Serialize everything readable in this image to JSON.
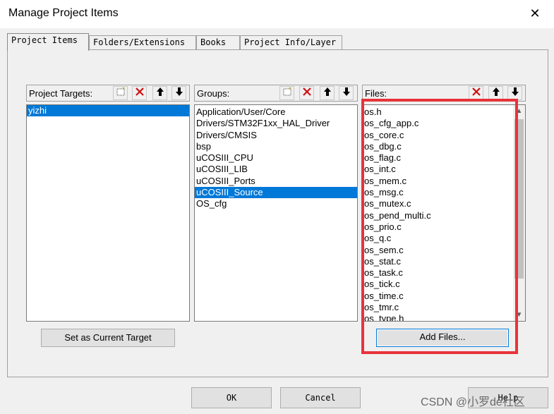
{
  "window": {
    "title": "Manage Project Items",
    "close_glyph": "✕"
  },
  "tabs": [
    {
      "label": "Project Items",
      "active": true
    },
    {
      "label": "Folders/Extensions",
      "active": false
    },
    {
      "label": "Books",
      "active": false
    },
    {
      "label": "Project Info/Layer",
      "active": false
    }
  ],
  "targets": {
    "label": "Project Targets:",
    "items": [
      "yizhi"
    ],
    "selected_index": 0
  },
  "groups": {
    "label": "Groups:",
    "items": [
      "Application/User/Core",
      "Drivers/STM32F1xx_HAL_Driver",
      "Drivers/CMSIS",
      "bsp",
      "uCOSIII_CPU",
      "uCOSIII_LIB",
      "uCOSIII_Ports",
      "uCOSIII_Source",
      "OS_cfg"
    ],
    "selected_index": 7
  },
  "files": {
    "label": "Files:",
    "items": [
      "os.h",
      "os_cfg_app.c",
      "os_core.c",
      "os_dbg.c",
      "os_flag.c",
      "os_int.c",
      "os_mem.c",
      "os_msg.c",
      "os_mutex.c",
      "os_pend_multi.c",
      "os_prio.c",
      "os_q.c",
      "os_sem.c",
      "os_stat.c",
      "os_task.c",
      "os_tick.c",
      "os_time.c",
      "os_tmr.c",
      "os_type.h"
    ]
  },
  "icons": {
    "new": "new-item-icon",
    "delete": "delete-icon",
    "up": "move-up-icon",
    "down": "move-down-icon"
  },
  "buttons": {
    "set_target": "Set as Current Target",
    "add_files": "Add Files...",
    "ok": "OK",
    "cancel": "Cancel",
    "help": "Help"
  },
  "watermark": "CSDN @小罗de社区",
  "colors": {
    "selection": "#0078d7",
    "highlight_box": "#e8333a",
    "delete_red": "#d01010"
  }
}
